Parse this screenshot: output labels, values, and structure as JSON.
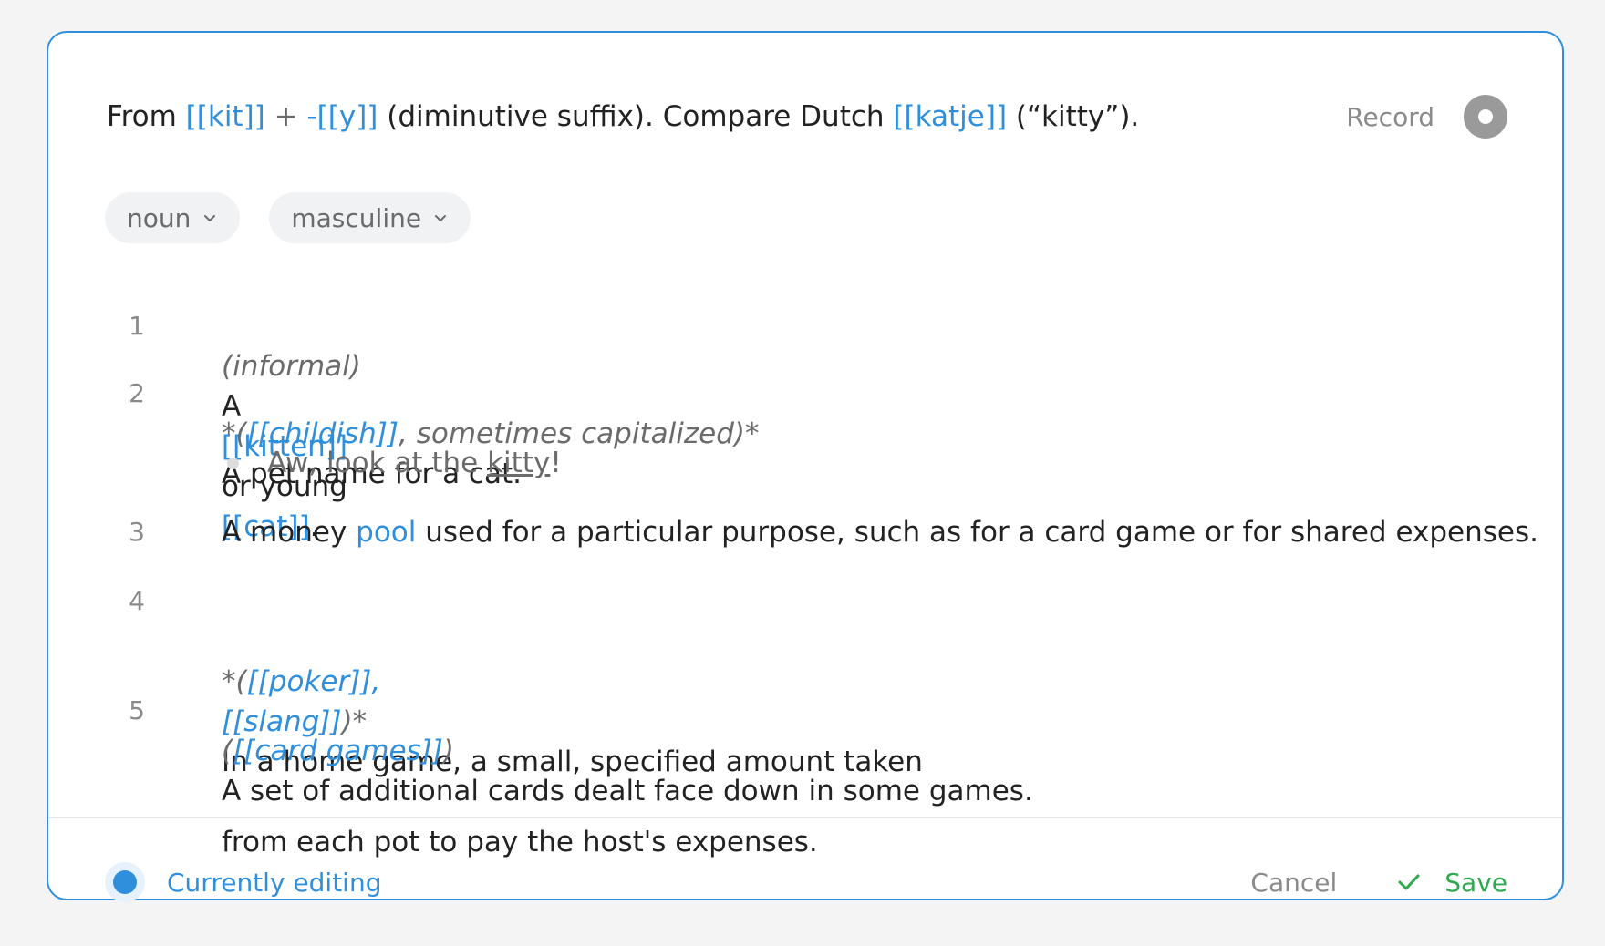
{
  "etymology": {
    "from": "From",
    "link_kit": "[[kit]]",
    "plus": "+",
    "link_y": "-[[y]]",
    "suffix_text": "(diminutive suffix). Compare Dutch",
    "link_katje": "[[katje]]",
    "gloss": "(“kitty”)."
  },
  "record": {
    "label": "Record",
    "icon": "record-icon"
  },
  "chips": {
    "part_of_speech": "noun",
    "gender": "masculine"
  },
  "definitions": [
    {
      "number": "1",
      "label": "(informal)",
      "pre": "A",
      "link1": "[[kitten]]",
      "mid": "or young",
      "link2": "[[cat]]",
      "end": "."
    },
    {
      "number": "2",
      "open": "*(",
      "link": "[[childish]]",
      "label_rest": ", sometimes capitalized)*",
      "body": "A pet name for a cat."
    },
    {
      "number": "3",
      "pre": "A money",
      "link": "pool",
      "body": "used for a particular purpose, such as for a card game or for shared expenses."
    },
    {
      "number": "4",
      "open": "*(",
      "link1": "[[poker]]",
      "sep": ",",
      "link2": "[[slang]]",
      "close": ")*",
      "body_line1": "In a home game, a small, specified amount taken",
      "body_line2": "from each pot to pay the host's expenses."
    },
    {
      "number": "5",
      "open": "(",
      "link": "[[card games]]",
      "close": ")",
      "body": "A set of additional cards dealt face down in some games."
    }
  ],
  "example": {
    "pre": "Aw, look at the",
    "word": "kitty",
    "post": "!"
  },
  "footer": {
    "status": "Currently editing",
    "cancel": "Cancel",
    "save": "Save"
  },
  "colors": {
    "accent": "#2f8fdc",
    "save": "#2fa84f",
    "muted": "#8a8a8a"
  }
}
